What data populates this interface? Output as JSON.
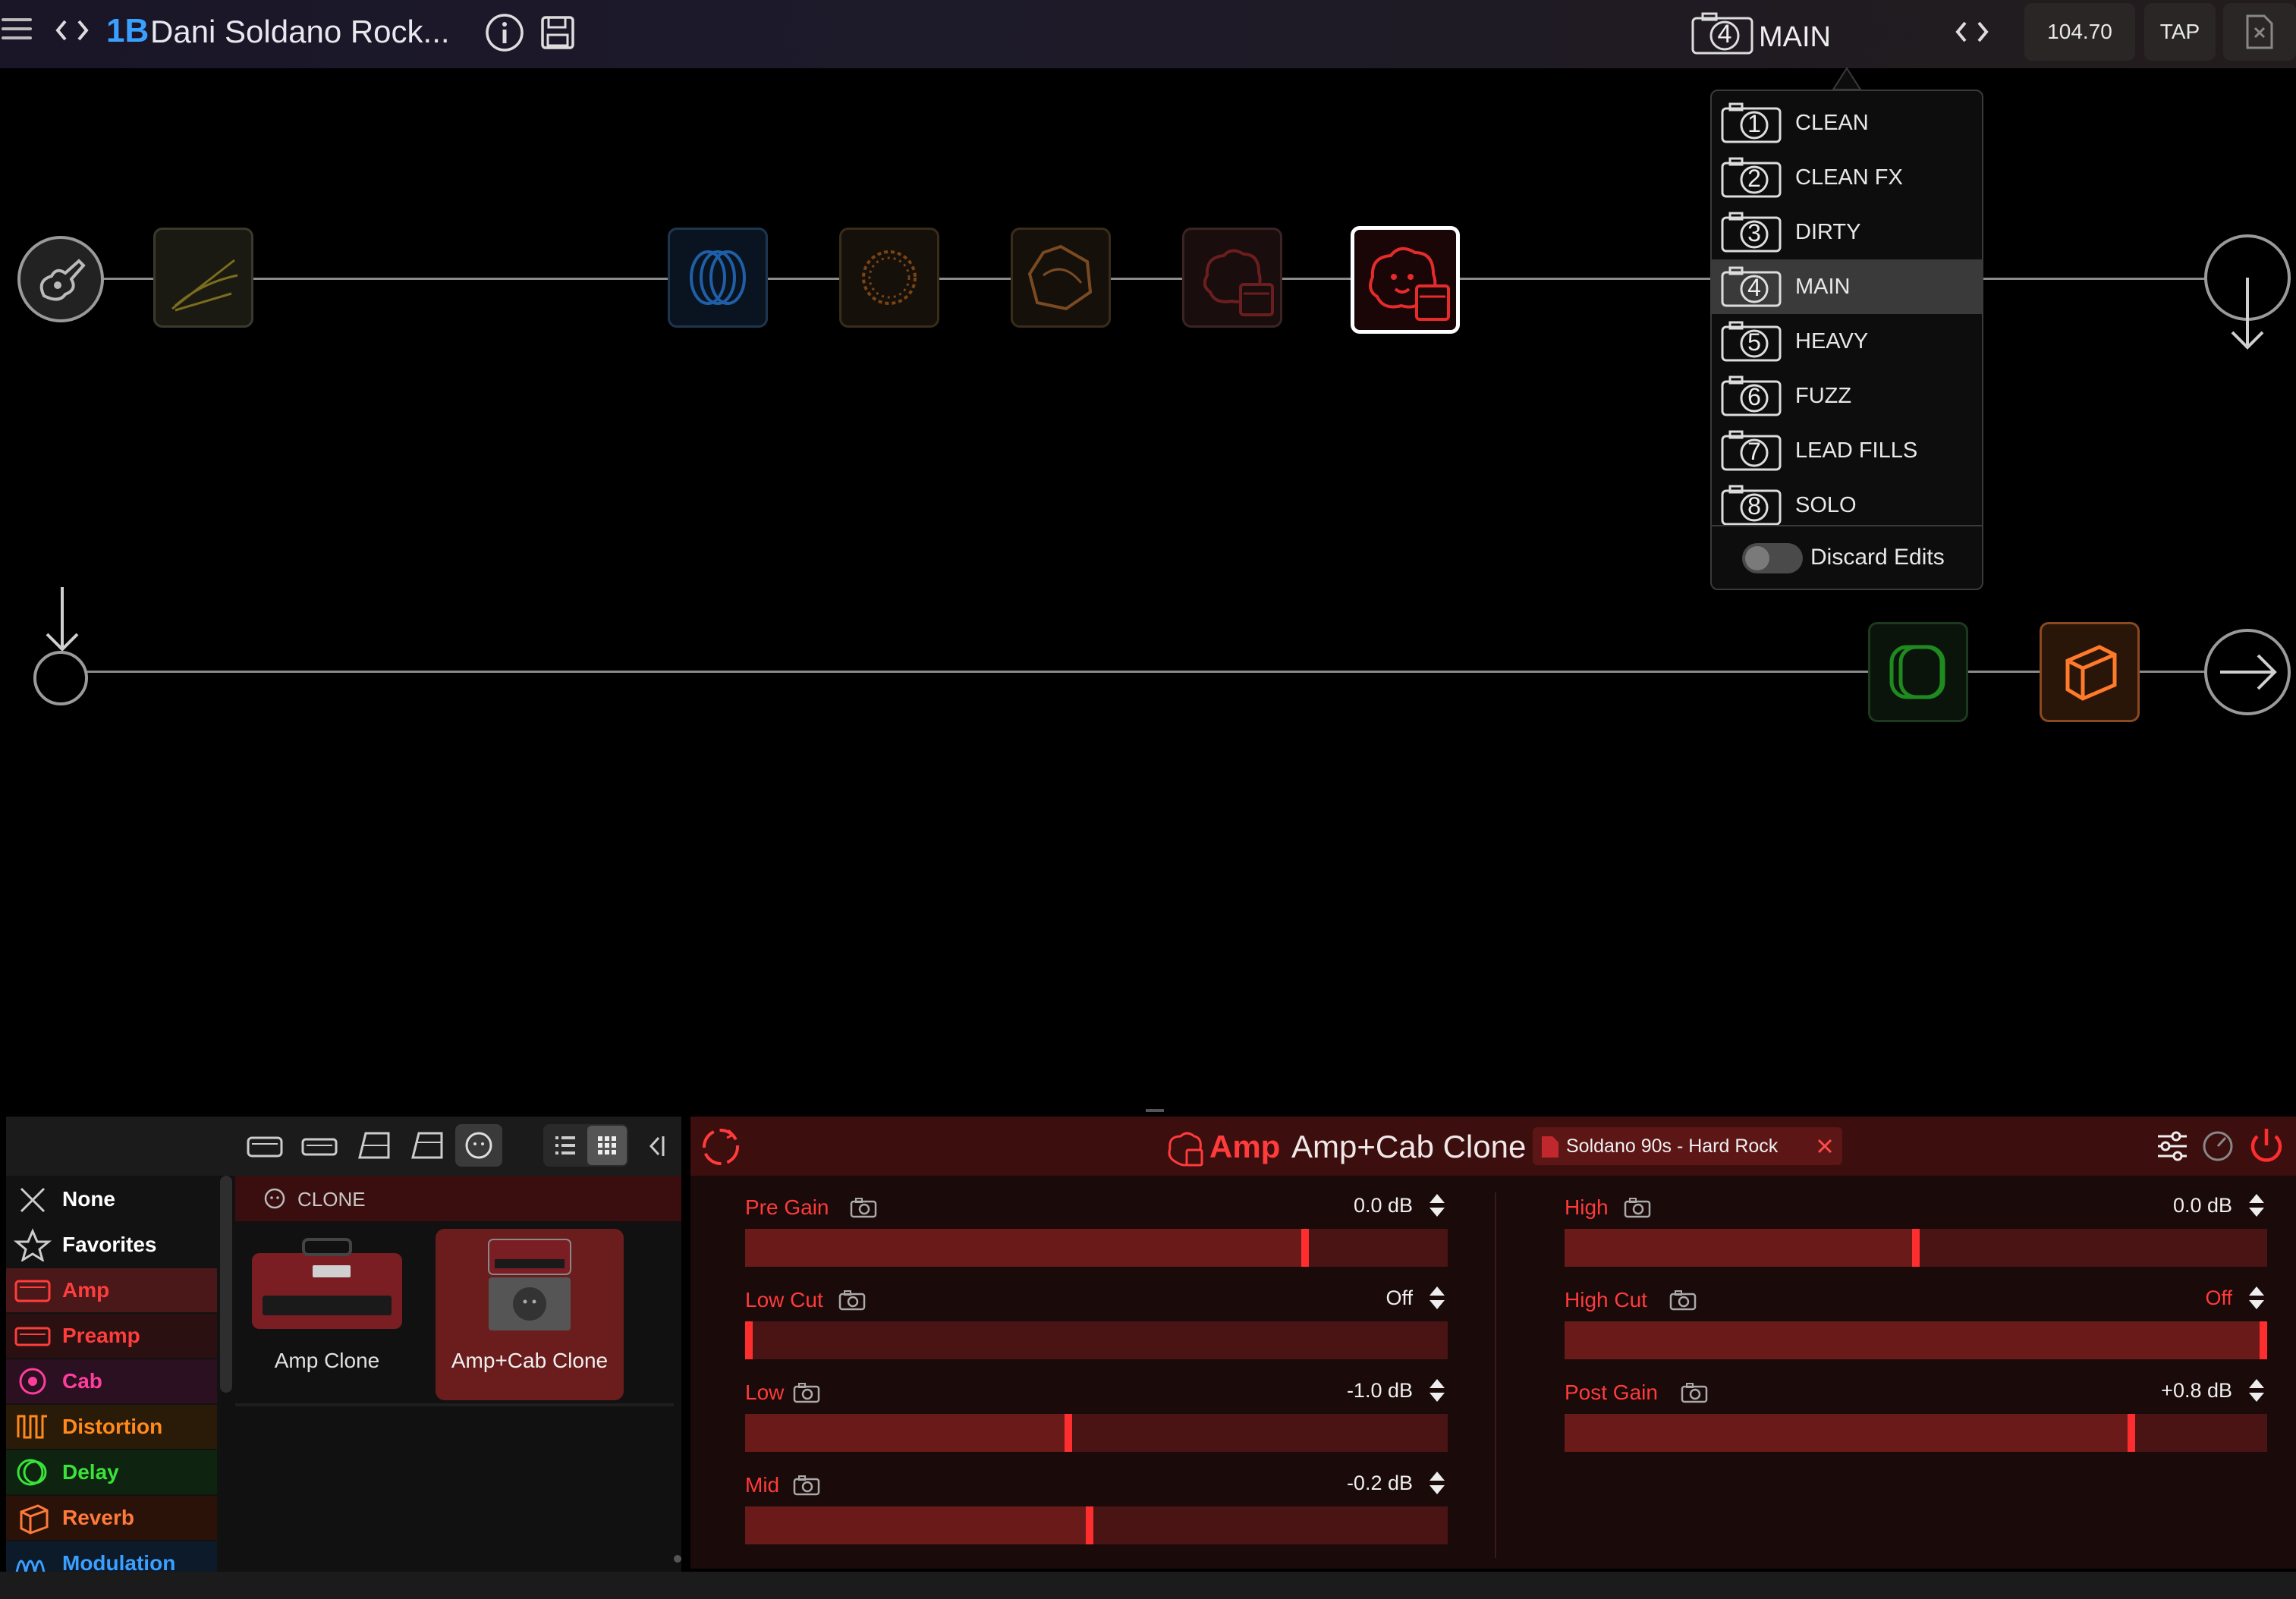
{
  "header": {
    "preset_id": "1B",
    "preset_name": "Dani Soldano Rock...",
    "snapshot_number": "4",
    "snapshot_name": "MAIN",
    "tempo": "104.70",
    "tap_label": "TAP"
  },
  "snapshots": {
    "items": [
      {
        "num": "1",
        "label": "CLEAN"
      },
      {
        "num": "2",
        "label": "CLEAN FX"
      },
      {
        "num": "3",
        "label": "DIRTY"
      },
      {
        "num": "4",
        "label": "MAIN"
      },
      {
        "num": "5",
        "label": "HEAVY"
      },
      {
        "num": "6",
        "label": "FUZZ"
      },
      {
        "num": "7",
        "label": "LEAD FILLS"
      },
      {
        "num": "8",
        "label": "SOLO"
      }
    ],
    "selected": "4",
    "discard_label": "Discard Edits"
  },
  "browser": {
    "categories": [
      {
        "label": "None",
        "color": "#ffffff",
        "icon": "x-icon"
      },
      {
        "label": "Favorites",
        "color": "#ffffff",
        "icon": "star-icon"
      },
      {
        "label": "Amp",
        "color": "#ff3d3d",
        "icon": "amp-icon"
      },
      {
        "label": "Preamp",
        "color": "#ff3d3d",
        "icon": "preamp-icon"
      },
      {
        "label": "Cab",
        "color": "#ff3d9d",
        "icon": "cab-icon"
      },
      {
        "label": "Distortion",
        "color": "#ff8a1a",
        "icon": "distortion-icon"
      },
      {
        "label": "Delay",
        "color": "#39e339",
        "icon": "delay-icon"
      },
      {
        "label": "Reverb",
        "color": "#ff7a3a",
        "icon": "reverb-icon"
      },
      {
        "label": "Modulation",
        "color": "#3aa0ff",
        "icon": "modulation-icon"
      }
    ],
    "section_title": "CLONE",
    "models": [
      {
        "label": "Amp Clone"
      },
      {
        "label": "Amp+Cab Clone"
      }
    ]
  },
  "editor": {
    "category": "Amp",
    "model": "Amp+Cab Clone",
    "clone_name": "Soldano 90s - Hard Rock",
    "params_left": [
      {
        "name": "Pre Gain",
        "value": "0.0 dB",
        "level": 0.8
      },
      {
        "name": "Low Cut",
        "value": "Off",
        "level": 0.0
      },
      {
        "name": "Low",
        "value": "-1.0 dB",
        "level": 0.46
      },
      {
        "name": "Mid",
        "value": "-0.2 dB",
        "level": 0.49
      }
    ],
    "params_right": [
      {
        "name": "High",
        "value": "0.0 dB",
        "level": 0.5
      },
      {
        "name": "High Cut",
        "value": "Off",
        "level": 1.0
      },
      {
        "name": "Post Gain",
        "value": "+0.8 dB",
        "level": 0.81
      }
    ]
  },
  "colors": {
    "accent_red": "#ff2e2e",
    "preset_id_blue": "#3aa0ff"
  }
}
